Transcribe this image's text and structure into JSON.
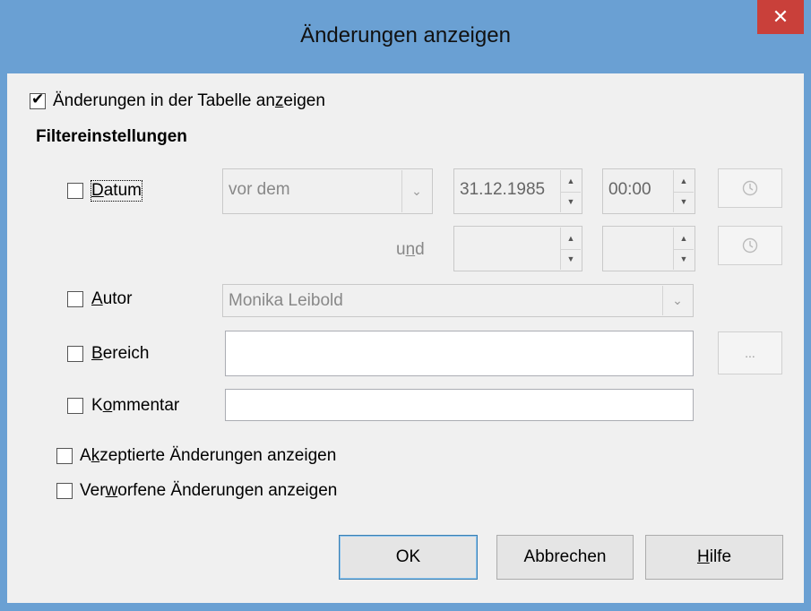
{
  "window": {
    "title": "Änderungen anzeigen",
    "close_glyph": "✕"
  },
  "show_changes": {
    "label_pre": "Änderungen in der Tabelle an",
    "label_key": "z",
    "label_post": "eigen",
    "checked": true
  },
  "filter_heading": "Filtereinstellungen",
  "date": {
    "label_key": "D",
    "label_rest": "atum",
    "checked": false,
    "condition": "vor dem",
    "start_date": "31.12.1985",
    "start_time": "00:00",
    "and_pre": "u",
    "and_key": "n",
    "and_post": "d",
    "end_date": "",
    "end_time": ""
  },
  "author": {
    "label_key": "A",
    "label_rest": "utor",
    "checked": false,
    "value": "Monika Leibold"
  },
  "range": {
    "label_key": "B",
    "label_rest": "ereich",
    "checked": false,
    "value": "",
    "browse_label": "..."
  },
  "comment": {
    "label_pre": "K",
    "label_key": "o",
    "label_post": "mmentar",
    "checked": false,
    "value": ""
  },
  "accepted": {
    "label_pre": "A",
    "label_key": "k",
    "label_post": "zeptierte Änderungen anzeigen",
    "checked": false
  },
  "rejected": {
    "label_pre": "Ver",
    "label_key": "w",
    "label_post": "orfene Änderungen anzeigen",
    "checked": false
  },
  "buttons": {
    "ok": "OK",
    "cancel": "Abbrechen",
    "help_key": "H",
    "help_rest": "ilfe"
  },
  "icons": {
    "clock": "clock-icon",
    "spin_up": "▲",
    "spin_down": "▼",
    "dropdown": "⌄"
  }
}
